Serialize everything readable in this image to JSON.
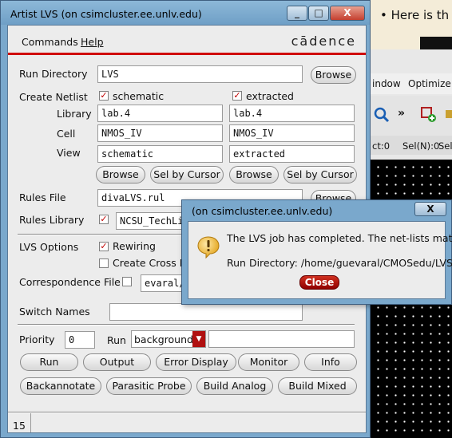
{
  "background": {
    "doc_bullet": "•  Here is th",
    "editor_menu": [
      "indow",
      "Optimize"
    ],
    "editor_status": [
      "ct:0",
      "Sel(N):0",
      "Sel"
    ]
  },
  "lvs_window": {
    "title": "Artist LVS (on csimcluster.ee.unlv.edu)",
    "title_buttons": [
      "_",
      "□",
      "X"
    ],
    "menu": [
      "Commands",
      "Help"
    ],
    "logo": "cādence",
    "run_directory": {
      "label": "Run Directory",
      "value": "LVS",
      "browse": "Browse"
    },
    "create_netlist": {
      "label": "Create Netlist",
      "schematic_label": "schematic",
      "extracted_label": "extracted",
      "library_label": "Library",
      "cell_label": "Cell",
      "view_label": "View",
      "schematic": {
        "library": "lab.4",
        "cell": "NMOS_IV",
        "view": "schematic"
      },
      "extracted": {
        "library": "lab.4",
        "cell": "NMOS_IV",
        "view": "extracted"
      },
      "browse": "Browse",
      "sel_by_cursor": "Sel by Cursor"
    },
    "rules_file": {
      "label": "Rules File",
      "value": "divaLVS.rul",
      "browse": "Browse"
    },
    "rules_library": {
      "label": "Rules Library",
      "value": "NCSU_TechLi"
    },
    "lvs_options": {
      "label": "LVS Options",
      "rewiring": "Rewiring",
      "create_cross": "Create Cross R"
    },
    "correspondence_file": {
      "label": "Correspondence File",
      "value": "evaral/"
    },
    "switch_names": {
      "label": "Switch Names",
      "value": ""
    },
    "priority": {
      "label": "Priority",
      "value": "0",
      "run_label": "Run",
      "run_value": "background"
    },
    "buttons_row1": [
      "Run",
      "Output",
      "Error Display",
      "Monitor",
      "Info"
    ],
    "buttons_row2": [
      "Backannotate",
      "Parasitic Probe",
      "Build Analog",
      "Build Mixed"
    ],
    "status": "15"
  },
  "dialog": {
    "title": "(on csimcluster.ee.unlv.edu)",
    "close_x": "X",
    "message": "The LVS job has completed. The net-lists match.",
    "run_dir": "Run Directory: /home/guevaral/CMOSedu/LVS",
    "close_button": "Close"
  },
  "colors": {
    "title_bar": "#7aa8cc",
    "accent_red": "#d00000",
    "canvas": "#000000"
  }
}
